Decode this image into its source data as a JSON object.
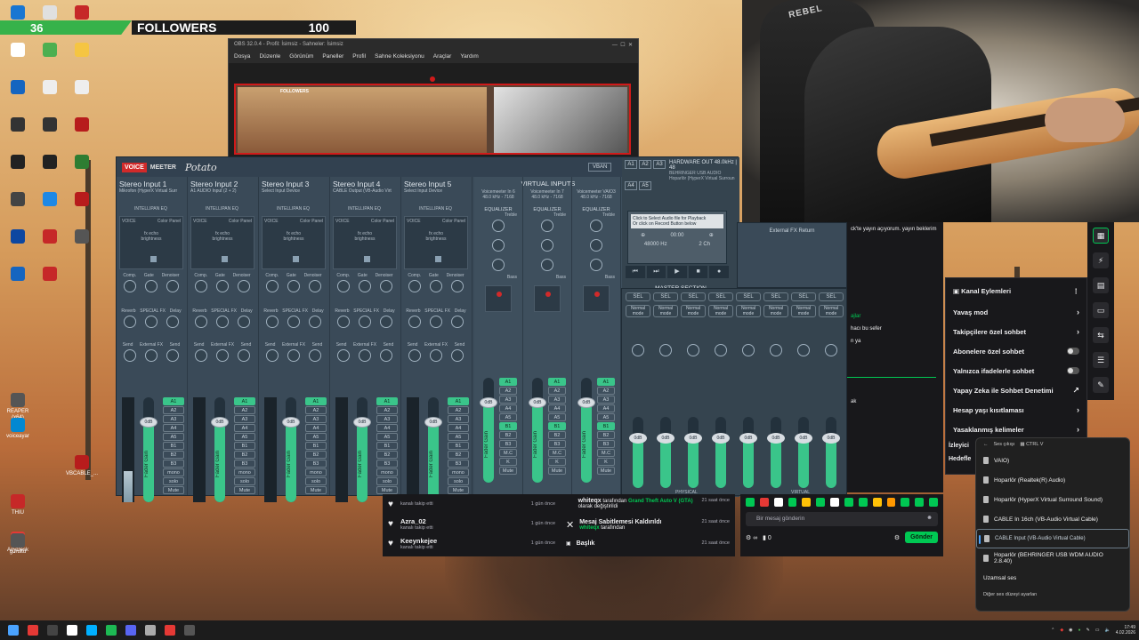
{
  "overlay": {
    "count_left": "36",
    "label": "FOLLOWERS",
    "count_right": "100"
  },
  "desktop_icons": [
    {
      "label": "",
      "color": "#1976d2"
    },
    {
      "label": "",
      "color": "#e0e0e0"
    },
    {
      "label": "",
      "color": "#c62828"
    },
    {
      "label": "",
      "color": "#ffffff"
    },
    {
      "label": "",
      "color": "#4caf50"
    },
    {
      "label": "",
      "color": "#f5c542"
    },
    {
      "label": "",
      "color": "#1565c0"
    },
    {
      "label": "",
      "color": "#eeeeee"
    },
    {
      "label": "",
      "color": "#eeeeee"
    },
    {
      "label": "",
      "color": "#333333"
    },
    {
      "label": "",
      "color": "#333333"
    },
    {
      "label": "",
      "color": "#b71c1c"
    },
    {
      "label": "",
      "color": "#222222"
    },
    {
      "label": "",
      "color": "#222222"
    },
    {
      "label": "",
      "color": "#2e7d32"
    },
    {
      "label": "",
      "color": "#444444"
    },
    {
      "label": "",
      "color": "#1e88e5"
    },
    {
      "label": "",
      "color": "#b71c1c"
    },
    {
      "label": "",
      "color": "#0d47a1"
    },
    {
      "label": "",
      "color": "#c62828"
    },
    {
      "label": "",
      "color": "#555555"
    },
    {
      "label": "",
      "color": "#1565c0"
    },
    {
      "label": "",
      "color": "#c62828"
    },
    {
      "label": "REAPER (x64)",
      "color": "#555555"
    },
    {
      "label": "voiceayar",
      "color": "#0288d1"
    },
    {
      "label": "VBCABLE_...",
      "color": "#b71c1c"
    },
    {
      "label": "THIU",
      "color": "#c62828"
    },
    {
      "label": "AnyDesk",
      "color": "#e53935"
    },
    {
      "label": "gürültü",
      "color": "#555555"
    }
  ],
  "obs": {
    "title": "OBS 32.0.4 - Profil: İsimsiz - Sahneler: İsimsiz",
    "menu": [
      "Dosya",
      "Düzenle",
      "Görünüm",
      "Paneller",
      "Profil",
      "Sahne Koleksiyonu",
      "Araçlar",
      "Yardım"
    ],
    "preview_overlay": "FOLLOWERS"
  },
  "webcam": {
    "chair_text": "REBEL"
  },
  "voicemeeter": {
    "brand_voice": "VOICE",
    "brand_meeter": "MEETER",
    "brand_potato": "Potato",
    "vban": "VBAN",
    "strips": [
      {
        "title": "Stereo Input 1",
        "device": "Mikrofon (HyperX Virtual Surr",
        "gain": "0dB",
        "level": 0.3,
        "fader": 0.76
      },
      {
        "title": "Stereo Input 2",
        "device": "A1 AUDIO Input (2 + 2)",
        "gain": "0dB",
        "level": 0,
        "fader": 0.76
      },
      {
        "title": "Stereo Input 3",
        "device": "Select Input Device",
        "gain": "0dB",
        "level": 0,
        "fader": 0.76
      },
      {
        "title": "Stereo Input 4",
        "device": "CABLE Output (VB-Audio Virt",
        "gain": "0dB",
        "level": 0,
        "fader": 0.76
      },
      {
        "title": "Stereo Input 5",
        "device": "Select Input Device",
        "gain": "0dB",
        "level": 0,
        "fader": 0.76
      }
    ],
    "intellipan": "INTELLIPAN",
    "eq": "EQ",
    "voice": "VOICE",
    "color_panel": "Color Panel",
    "fx_echo": "fx echo",
    "brightness": "brightness",
    "knob_labels_1": [
      "Comp.",
      "Gate",
      "Denoiser"
    ],
    "knob_labels_2": [
      "Reverb",
      "SPECIAL FX",
      "Delay"
    ],
    "knob_labels_3": [
      "Send",
      "External FX",
      "Send"
    ],
    "fader_gain": "Fader Gain",
    "bus_buttons": [
      "A1",
      "A2",
      "A3",
      "A4",
      "A5",
      "B1",
      "B2",
      "B3",
      "mono",
      "solo",
      "Mute"
    ],
    "virtual_inputs": "VIRTUAL INPUTS",
    "virtual_strips": [
      {
        "name": "Voicemeeter In 6",
        "rate": "48.0 kHz - 7168"
      },
      {
        "name": "Voicemeeter In 7",
        "rate": "48.0 kHz - 7168"
      },
      {
        "name": "Voicemeeter VAIO3",
        "rate": "48.0 kHz - 7168"
      }
    ],
    "equalizer": "EQUALIZER",
    "treble": "Treble",
    "bass": "Bass",
    "virtual_bus_buttons": [
      "A1",
      "A2",
      "A3",
      "A4",
      "A5",
      "B1",
      "B2",
      "B3",
      "M.C",
      "K",
      "Mute"
    ],
    "hw_buttons": [
      "A1",
      "A2",
      "A3",
      "A4",
      "A5"
    ],
    "hardware_out": "HARDWARE OUT",
    "hw_rate": "48.0kHz | 48",
    "hw_device_1": "BEHRINGER USB AUDIO",
    "hw_device_2": "Hoparlör (HyperX Virtual Surroun",
    "recorder_msg_1": "Click to Select Audio file for Playback",
    "recorder_msg_2": "Or click on Record Button below",
    "recorder_time": "00:00",
    "recorder_rate": "48000 Hz",
    "recorder_ch": "2 Ch",
    "transport": [
      "⏮",
      "⏭",
      "▶",
      "■",
      "●"
    ],
    "master_section": "MASTER SECTION",
    "sel": "SEL",
    "normal_mode": "Normal mode",
    "master_gain": "0dB",
    "ext_fx_return": "External FX Return",
    "physical": "PHYSICAL",
    "virtual": "VIRTUAL"
  },
  "chat": {
    "lines": [
      "ck'te yayın açıyorum. yayın beklerim",
      "ajlar",
      "hacı bu sefer",
      "n ya",
      "ak"
    ]
  },
  "kanal": {
    "title": "Kanal Eylemleri",
    "items": [
      {
        "label": "Yavaş mod",
        "kind": "chevron"
      },
      {
        "label": "Takipçilere özel sohbet",
        "kind": "chevron"
      },
      {
        "label": "Abonelere özel sohbet",
        "kind": "toggle"
      },
      {
        "label": "Yalnızca ifadelerle sohbet",
        "kind": "toggle"
      },
      {
        "label": "Yapay Zeka ile Sohbet Denetimi",
        "kind": "ext"
      },
      {
        "label": "Hesap yaşı kısıtlaması",
        "kind": "chevron"
      },
      {
        "label": "Yasaklanmış kelimeler",
        "kind": "chevron"
      }
    ],
    "partial_1": "İzleyici",
    "partial_2": "Hedefle"
  },
  "feed": [
    {
      "name": "",
      "sub": "kanalı takip etti",
      "when": "1 gün önce"
    },
    {
      "name": "Azra_02",
      "sub": "kanalı takip etti",
      "when": "1 gün önce"
    },
    {
      "name": "Keeynkejee",
      "sub": "kanalı takip etti",
      "when": "1 gün önce"
    }
  ],
  "activity": [
    {
      "user": "whiteqx",
      "text_1": "tarafından",
      "highlight": "Grand Theft Auto V (GTA)",
      "text_2": "olarak değiştirildi",
      "when": "21 saat önce"
    },
    {
      "title": "Mesaj Sabitlemesi Kaldırıldı",
      "user": "whiteqx",
      "text_1": "tarafından",
      "when": "21 saat önce"
    },
    {
      "title": "Başlık",
      "when": "21 saat önce"
    }
  ],
  "sendbox": {
    "placeholder": "Bir mesaj gönderin",
    "points": "∞",
    "count": "0",
    "send": "Gönder",
    "emote_colors": [
      "#00c853",
      "#e53935",
      "#ffffff",
      "#00c853",
      "#ffc107",
      "#00c853",
      "#ffffff",
      "#00c853",
      "#00c853",
      "#ffc107",
      "#ff9800",
      "#00c853",
      "#00c853",
      "#00c853"
    ]
  },
  "flyout": {
    "header": "Ses çıkışı",
    "shortcut": "CTRL",
    "shortcut_2": "V",
    "items": [
      {
        "label": "VAIO)",
        "selected": false
      },
      {
        "label": "Hoparlör (Realtek(R) Audio)",
        "selected": false
      },
      {
        "label": "Hoparlör (HyperX Virtual Surround Sound)",
        "selected": false
      },
      {
        "label": "CABLE In 16ch (VB-Audio Virtual Cable)",
        "selected": false
      },
      {
        "label": "CABLE Input (VB-Audio Virtual Cable)",
        "selected": true
      },
      {
        "label": "Hoparlör (BEHRINGER USB WDM AUDIO 2.8.40)",
        "selected": false
      }
    ],
    "spatial": "Uzamsal ses",
    "more": "Diğer ses düzeyi ayarları"
  },
  "taskbar": {
    "icons": [
      "#4aa3ff",
      "#e53935",
      "#444444",
      "#ffffff",
      "#00b0ff",
      "#1db954",
      "#5865f2",
      "#aaaaaa",
      "#e53935",
      "#555555"
    ],
    "time": "17:49",
    "date": "4.02.2026"
  }
}
